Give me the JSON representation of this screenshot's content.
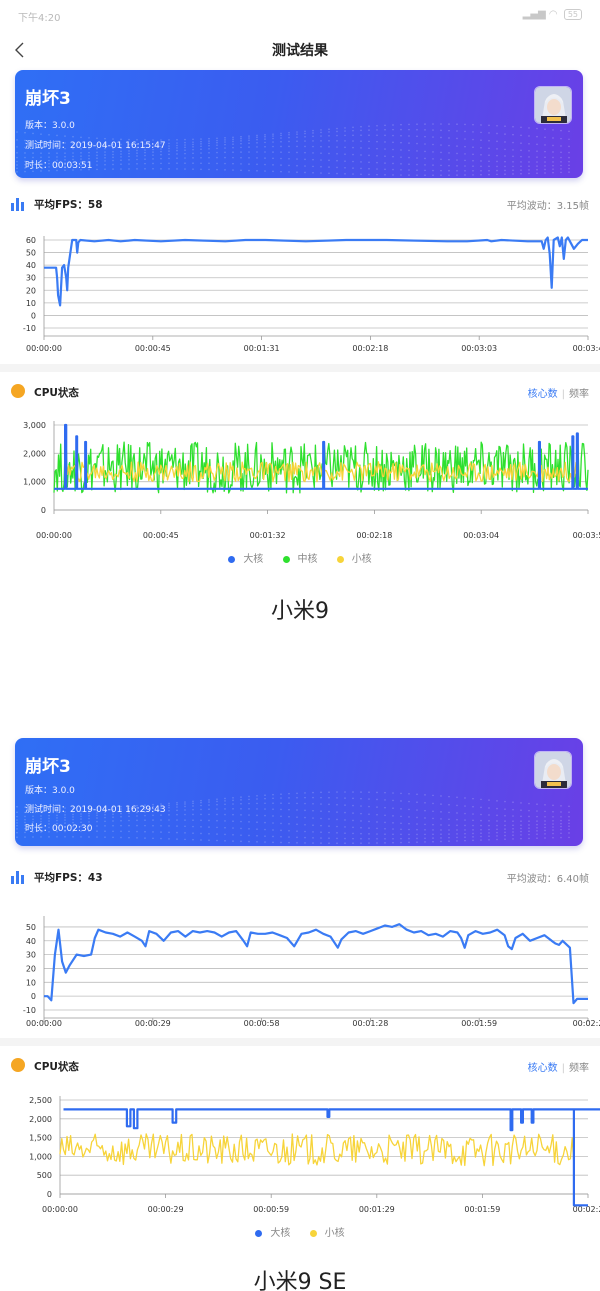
{
  "status_bar": {
    "time": "下午4:20",
    "battery": "55"
  },
  "nav": {
    "title": "测试结果"
  },
  "colors": {
    "accent": "#3a7bf4",
    "big_core": "#2f6bf0",
    "mid_core": "#2ee02e",
    "little_core": "#f7d43a",
    "fps_line": "#3a7bf4",
    "cpu_icon": "#f5a623"
  },
  "reports": [
    {
      "game_title": "崩坏3",
      "version": "版本：3.0.0",
      "test_time": "测试时间：2019-04-01 16:15:47",
      "duration": "时长：00:03:51",
      "avg_fps_label": "平均FPS：58",
      "fluctuation": "平均波动：3.15帧",
      "cpu_label": "CPU状态",
      "tab_cores": "核心数",
      "tab_freq": "频率",
      "legend": [
        "大核",
        "中核",
        "小核"
      ],
      "caption": "小米9"
    },
    {
      "game_title": "崩坏3",
      "version": "版本：3.0.0",
      "test_time": "测试时间：2019-04-01 16:29:43",
      "duration": "时长：00:02:30",
      "avg_fps_label": "平均FPS：43",
      "fluctuation": "平均波动：6.40帧",
      "cpu_label": "CPU状态",
      "tab_cores": "核心数",
      "tab_freq": "频率",
      "legend": [
        "大核",
        "小核"
      ],
      "caption": "小米9 SE"
    }
  ],
  "chart_data": [
    {
      "type": "line",
      "yticks": [
        "60",
        "50",
        "40",
        "30",
        "20",
        "10",
        "0",
        "-10"
      ],
      "ylim": [
        -10,
        60
      ],
      "xticks": [
        "00:00:00",
        "00:00:45",
        "00:01:31",
        "00:02:18",
        "00:03:03",
        "00:03:4"
      ],
      "series": [
        {
          "color": "#3a7bf4",
          "points": [
            [
              0,
              38
            ],
            [
              6,
              38
            ],
            [
              6.5,
              30
            ],
            [
              7,
              16
            ],
            [
              8,
              8
            ],
            [
              9,
              38
            ],
            [
              10,
              40
            ],
            [
              11,
              30
            ],
            [
              11.5,
              20
            ],
            [
              12,
              38
            ],
            [
              14,
              60
            ],
            [
              16,
              60
            ],
            [
              16.5,
              50
            ],
            [
              17,
              58
            ],
            [
              18,
              60
            ],
            [
              25,
              59
            ],
            [
              32,
              60
            ],
            [
              38,
              59
            ],
            [
              45,
              60
            ],
            [
              58,
              59
            ],
            [
              70,
              60
            ],
            [
              90,
              59
            ],
            [
              100,
              60
            ],
            [
              110,
              60
            ],
            [
              130,
              59
            ],
            [
              150,
              60
            ],
            [
              170,
              60
            ],
            [
              200,
              59
            ],
            [
              210,
              59
            ],
            [
              220,
              60
            ],
            [
              222,
              59
            ],
            [
              227,
              60
            ],
            [
              240,
              59
            ],
            [
              247,
              59
            ],
            [
              248,
              53
            ],
            [
              249,
              60
            ],
            [
              250,
              62
            ],
            [
              251,
              49
            ],
            [
              252,
              22
            ],
            [
              253,
              60
            ],
            [
              255,
              62
            ],
            [
              256,
              55
            ],
            [
              257,
              62
            ],
            [
              258,
              45
            ],
            [
              259,
              60
            ],
            [
              260,
              62
            ],
            [
              263,
              53
            ],
            [
              265,
              57
            ],
            [
              267,
              60
            ],
            [
              270,
              60
            ]
          ]
        }
      ]
    },
    {
      "type": "line",
      "yticks": [
        "3,000",
        "2,000",
        "1,000",
        "0"
      ],
      "ylim": [
        0,
        3000
      ],
      "xticks": [
        "00:00:00",
        "00:00:45",
        "00:01:32",
        "00:02:18",
        "00:03:04",
        "00:03:5"
      ],
      "series": [
        {
          "name": "大核",
          "color": "#2f6bf0",
          "style": "steady",
          "base": 750,
          "spikes": [
            [
              5,
              3000,
              0.5
            ],
            [
              10,
              2600,
              0.4
            ],
            [
              14,
              2400,
              0.4
            ],
            [
              121,
              2400,
              0.4
            ],
            [
              218,
              2400,
              0.4
            ],
            [
              233,
              2600,
              0.4
            ],
            [
              235,
              2700,
              0.4
            ]
          ]
        },
        {
          "name": "中核",
          "color": "#2ee02e",
          "style": "noisy",
          "lo": 600,
          "hi": 2400
        },
        {
          "name": "小核",
          "color": "#f7d43a",
          "style": "mid",
          "lo": 1000,
          "hi": 1700
        }
      ]
    },
    {
      "type": "line",
      "yticks": [
        "50",
        "40",
        "30",
        "20",
        "10",
        "0",
        "-10"
      ],
      "ylim": [
        -10,
        55
      ],
      "xticks": [
        "00:00:00",
        "00:00:29",
        "00:00:58",
        "00:01:28",
        "00:01:59",
        "00:02:2"
      ],
      "series": [
        {
          "color": "#3a7bf4",
          "points": [
            [
              0,
              0
            ],
            [
              1,
              0
            ],
            [
              2,
              -3
            ],
            [
              3,
              30
            ],
            [
              4,
              48
            ],
            [
              5,
              25
            ],
            [
              6,
              17
            ],
            [
              7,
              22
            ],
            [
              9,
              30
            ],
            [
              11,
              29
            ],
            [
              13,
              30
            ],
            [
              14,
              42
            ],
            [
              15,
              48
            ],
            [
              17,
              46
            ],
            [
              19,
              45
            ],
            [
              21,
              43
            ],
            [
              23,
              46
            ],
            [
              25,
              43
            ],
            [
              27,
              40
            ],
            [
              28,
              36
            ],
            [
              29,
              47
            ],
            [
              31,
              45
            ],
            [
              33,
              40
            ],
            [
              35,
              46
            ],
            [
              37,
              47
            ],
            [
              39,
              43
            ],
            [
              41,
              47
            ],
            [
              43,
              46
            ],
            [
              45,
              47
            ],
            [
              47,
              46
            ],
            [
              49,
              43
            ],
            [
              51,
              46
            ],
            [
              53,
              47
            ],
            [
              55,
              40
            ],
            [
              56,
              36
            ],
            [
              57,
              46
            ],
            [
              59,
              45
            ],
            [
              61,
              45
            ],
            [
              63,
              46
            ],
            [
              65,
              44
            ],
            [
              67,
              42
            ],
            [
              69,
              36
            ],
            [
              71,
              45
            ],
            [
              73,
              46
            ],
            [
              75,
              48
            ],
            [
              77,
              45
            ],
            [
              79,
              43
            ],
            [
              81,
              35
            ],
            [
              82,
              41
            ],
            [
              84,
              46
            ],
            [
              86,
              47
            ],
            [
              88,
              45
            ],
            [
              90,
              47
            ],
            [
              92,
              49
            ],
            [
              94,
              51
            ],
            [
              96,
              50
            ],
            [
              98,
              52
            ],
            [
              100,
              48
            ],
            [
              102,
              46
            ],
            [
              104,
              47
            ],
            [
              106,
              44
            ],
            [
              108,
              45
            ],
            [
              110,
              43
            ],
            [
              112,
              47
            ],
            [
              114,
              46
            ],
            [
              115,
              42
            ],
            [
              116,
              35
            ],
            [
              117,
              44
            ],
            [
              119,
              47
            ],
            [
              121,
              45
            ],
            [
              123,
              46
            ],
            [
              125,
              48
            ],
            [
              127,
              44
            ],
            [
              128,
              36
            ],
            [
              129,
              34
            ],
            [
              130,
              42
            ],
            [
              132,
              45
            ],
            [
              134,
              40
            ],
            [
              136,
              42
            ],
            [
              138,
              44
            ],
            [
              140,
              40
            ],
            [
              141,
              38
            ],
            [
              142,
              37
            ],
            [
              143,
              40
            ],
            [
              145,
              35
            ],
            [
              146,
              -5
            ],
            [
              147,
              -2
            ],
            [
              150,
              -2
            ]
          ]
        }
      ]
    },
    {
      "type": "line",
      "yticks": [
        "2,500",
        "2,000",
        "1,500",
        "1,000",
        "500",
        "0"
      ],
      "ylim": [
        0,
        2500
      ],
      "xticks": [
        "00:00:00",
        "00:00:29",
        "00:00:59",
        "00:01:29",
        "00:01:59",
        "00:02:2"
      ],
      "series": [
        {
          "name": "大核",
          "color": "#2f6bf0",
          "style": "steady",
          "base": 2250,
          "start": 1,
          "end": 146,
          "dips": [
            [
              19,
              1800,
              1
            ],
            [
              21,
              1750,
              1
            ],
            [
              32,
              1900,
              1
            ],
            [
              76,
              2050,
              0.5
            ],
            [
              128,
              1700,
              0.5
            ],
            [
              131,
              1900,
              0.5
            ],
            [
              134,
              1900,
              0.5
            ],
            [
              156,
              2200,
              0.3
            ]
          ],
          "tail": -300
        },
        {
          "name": "小核",
          "color": "#f7d43a",
          "style": "noisy",
          "lo": 750,
          "hi": 1600,
          "end": 146
        }
      ]
    }
  ]
}
